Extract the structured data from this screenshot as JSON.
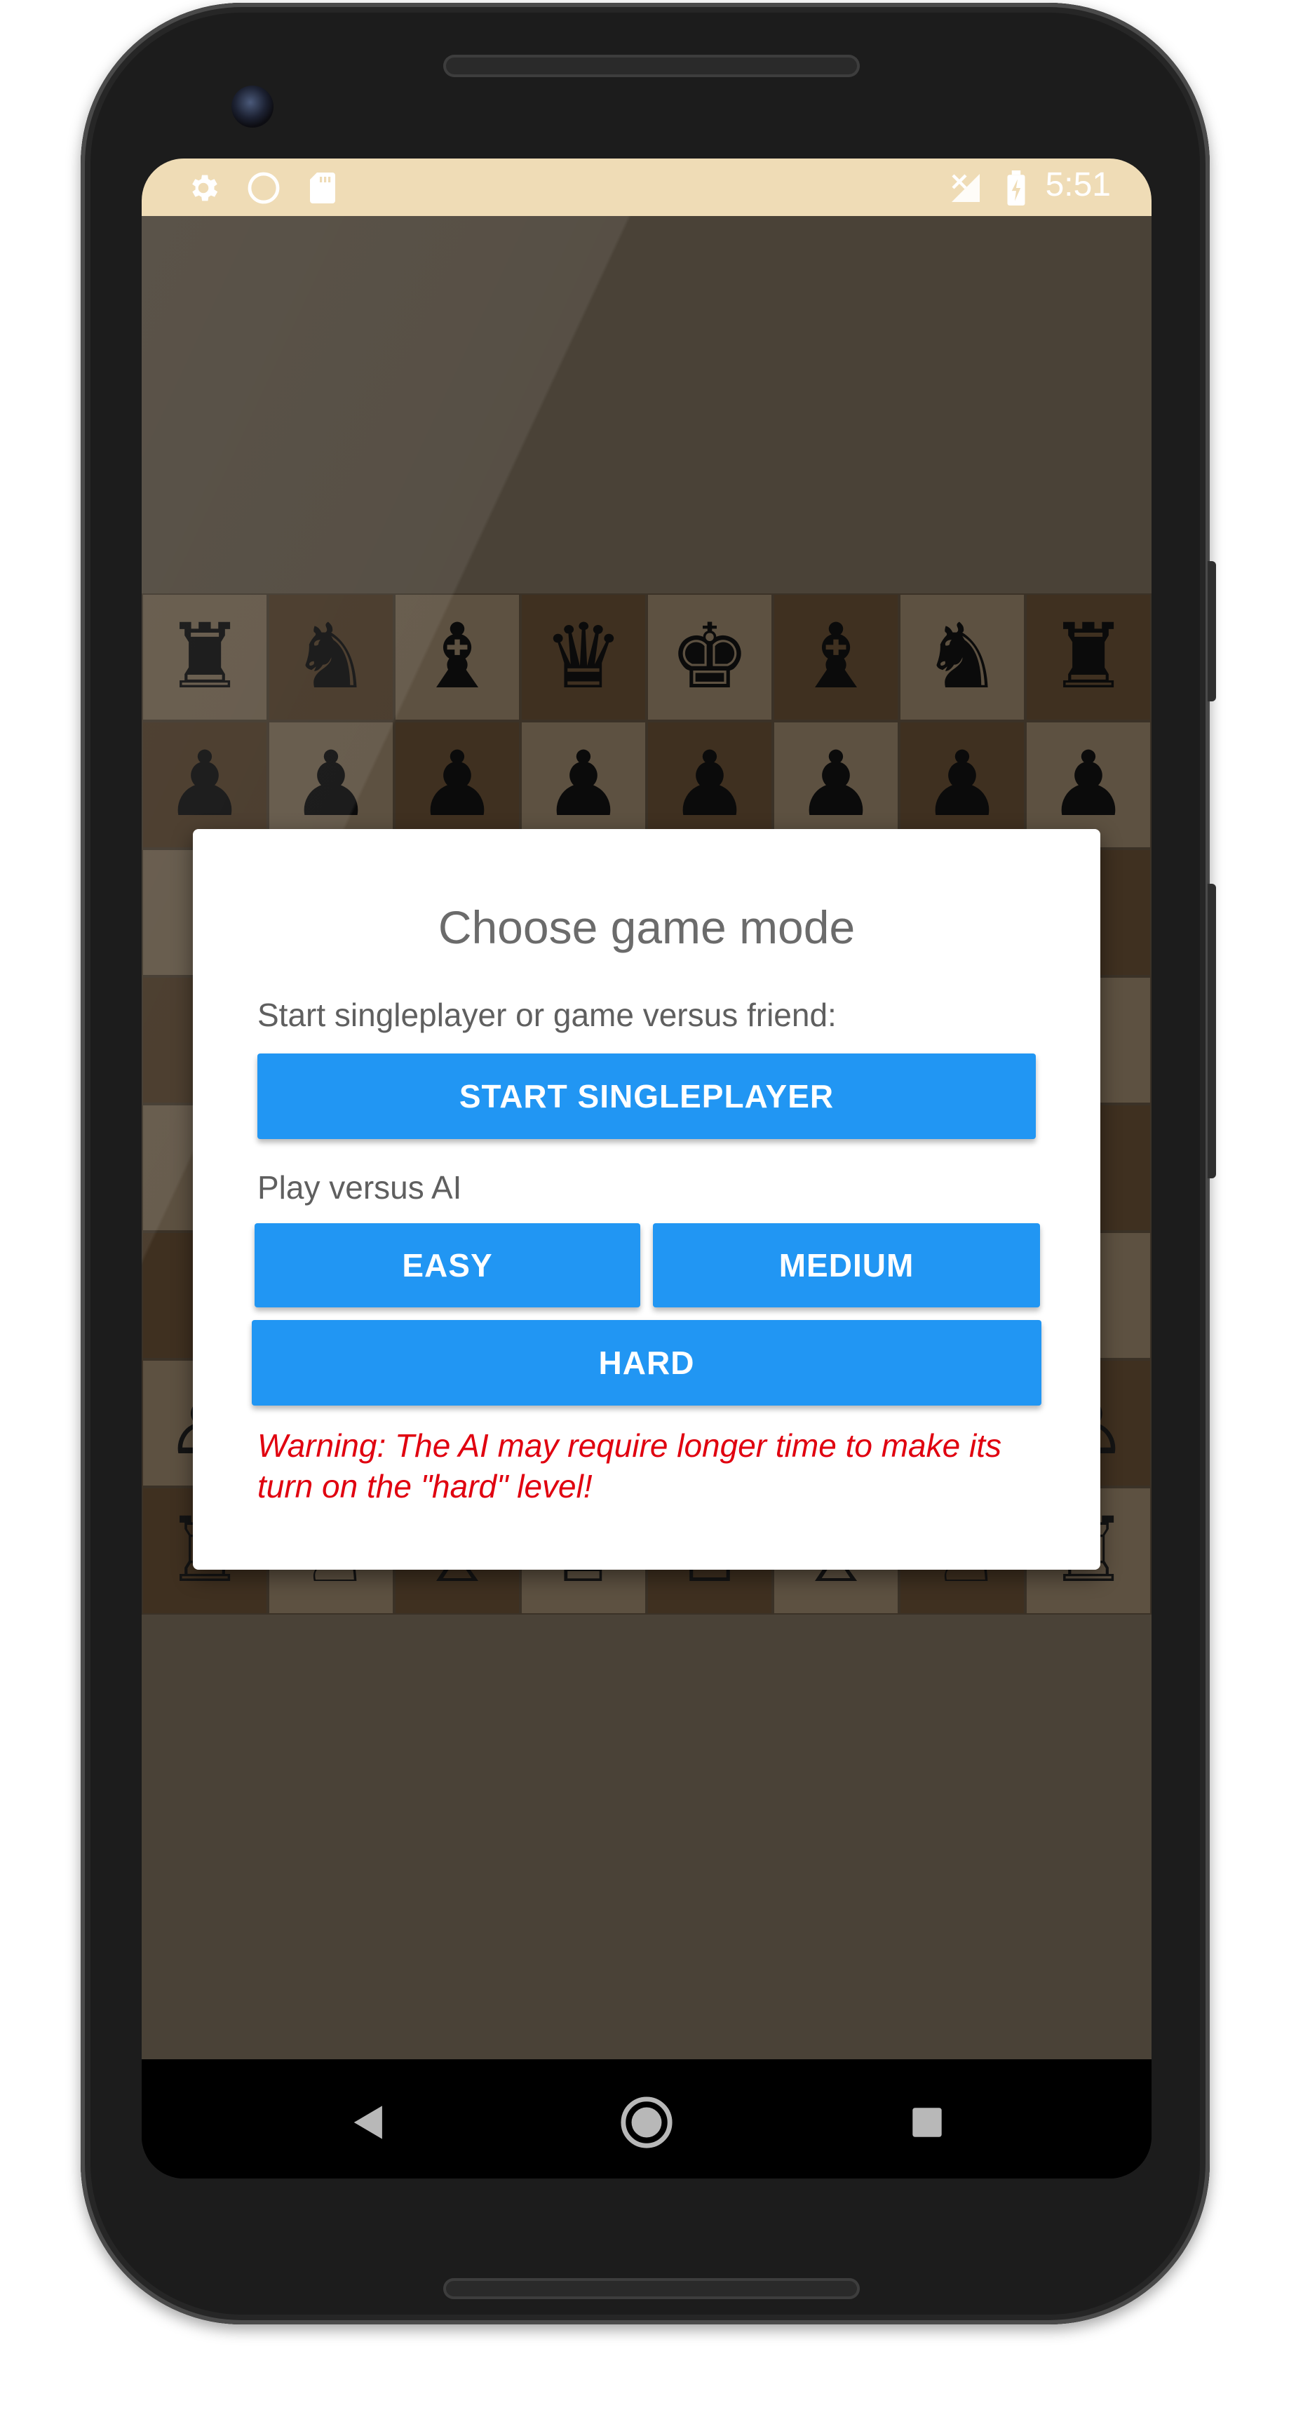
{
  "status_bar": {
    "time": "5:51",
    "left_icons": [
      "gear-icon",
      "circle-icon",
      "sd-card-icon"
    ],
    "right_icons": [
      "no-signal-icon",
      "battery-charging-icon"
    ]
  },
  "board": {
    "rows": [
      [
        "♜",
        "♞",
        "♝",
        "♛",
        "♚",
        "♝",
        "♞",
        "♜"
      ],
      [
        "♟",
        "♟",
        "♟",
        "♟",
        "♟",
        "♟",
        "♟",
        "♟"
      ],
      [
        "",
        "",
        "",
        "",
        "",
        "",
        "",
        ""
      ],
      [
        "",
        "",
        "",
        "",
        "",
        "",
        "",
        ""
      ],
      [
        "",
        "",
        "",
        "",
        "",
        "",
        "",
        ""
      ],
      [
        "",
        "",
        "",
        "",
        "",
        "",
        "",
        ""
      ],
      [
        "♙",
        "♙",
        "♙",
        "♙",
        "♙",
        "♙",
        "♙",
        "♙"
      ],
      [
        "♖",
        "♘",
        "♗",
        "♕",
        "♔",
        "♗",
        "♘",
        "♖"
      ]
    ]
  },
  "dialog": {
    "title": "Choose game mode",
    "intro": "Start singleplayer or game versus friend:",
    "start_singleplayer_label": "START SINGLEPLAYER",
    "ai_label": "Play versus AI",
    "easy_label": "EASY",
    "medium_label": "MEDIUM",
    "hard_label": "HARD",
    "warning_line1": "Warning: The AI may require longer time to make its",
    "warning_line2": "turn on the \"hard\" level!"
  },
  "nav_bar": {
    "icons": [
      "back-icon",
      "home-icon",
      "recents-icon"
    ]
  },
  "colors": {
    "accent": "#2196f3",
    "warning": "#e0000f",
    "status_bar": "#efdcb6",
    "board_light": "#5d5141",
    "board_dark": "#3f3020"
  }
}
